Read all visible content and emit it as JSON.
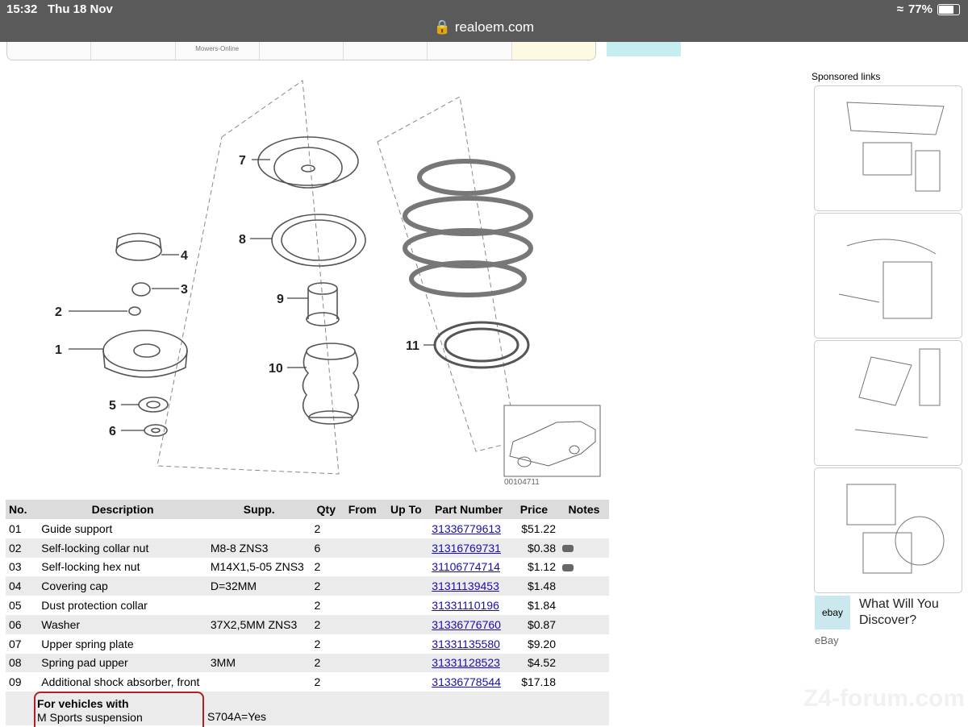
{
  "status_bar": {
    "time": "15:32",
    "date": "Thu 18 Nov",
    "url": "realoem.com",
    "battery": "77%"
  },
  "thumb_strip": [
    "",
    "",
    "Mowers-Online",
    "",
    "",
    "",
    ""
  ],
  "diagram": {
    "code": "00104711",
    "callouts": [
      "1",
      "2",
      "3",
      "4",
      "5",
      "6",
      "7",
      "8",
      "9",
      "10",
      "11"
    ]
  },
  "table": {
    "headers": [
      "No.",
      "Description",
      "Supp.",
      "Qty",
      "From",
      "Up To",
      "Part Number",
      "Price",
      "Notes"
    ],
    "rows": [
      {
        "no": "01",
        "desc": "Guide support",
        "supp": "",
        "qty": "2",
        "part": "31336779613",
        "price": "$51.22",
        "note": false
      },
      {
        "no": "02",
        "desc": "Self-locking collar nut",
        "supp": "M8-8 ZNS3",
        "qty": "6",
        "part": "31316769731",
        "price": "$0.38",
        "note": true
      },
      {
        "no": "03",
        "desc": "Self-locking hex nut",
        "supp": "M14X1,5-05 ZNS3",
        "qty": "2",
        "part": "31106774714",
        "price": "$1.12",
        "note": true
      },
      {
        "no": "04",
        "desc": "Covering cap",
        "supp": "D=32MM",
        "qty": "2",
        "part": "31311139453",
        "price": "$1.48",
        "note": false
      },
      {
        "no": "05",
        "desc": "Dust protection collar",
        "supp": "",
        "qty": "2",
        "part": "31331110196",
        "price": "$1.84",
        "note": false
      },
      {
        "no": "06",
        "desc": "Washer",
        "supp": "37X2,5MM ZNS3",
        "qty": "2",
        "part": "31336776760",
        "price": "$0.87",
        "note": false
      },
      {
        "no": "07",
        "desc": "Upper spring plate",
        "supp": "",
        "qty": "2",
        "part": "31331135580",
        "price": "$9.20",
        "note": false
      },
      {
        "no": "08",
        "desc": "Spring pad upper",
        "supp": "3MM",
        "qty": "2",
        "part": "31331128523",
        "price": "$4.52",
        "note": false
      },
      {
        "no": "09",
        "desc": "Additional shock absorber, front",
        "supp": "",
        "qty": "2",
        "part": "31336778544",
        "price": "$17.18",
        "note": false
      }
    ]
  },
  "vehicle_note": {
    "line1": "For vehicles with",
    "line2": "M Sports suspension",
    "value": "S704A=Yes"
  },
  "sidebar": {
    "sponsored_label": "Sponsored links",
    "ad_title": "What Will You Discover?",
    "ad_source": "eBay",
    "ad_logo": "ebay"
  },
  "watermark": "Z4-forum.com",
  "colors": {
    "status_bar": "#5a5a5a",
    "link": "#1a0dab",
    "row_alt": "#ebebeb",
    "header_bg": "#dcdcdc",
    "note_border": "#b02020"
  }
}
